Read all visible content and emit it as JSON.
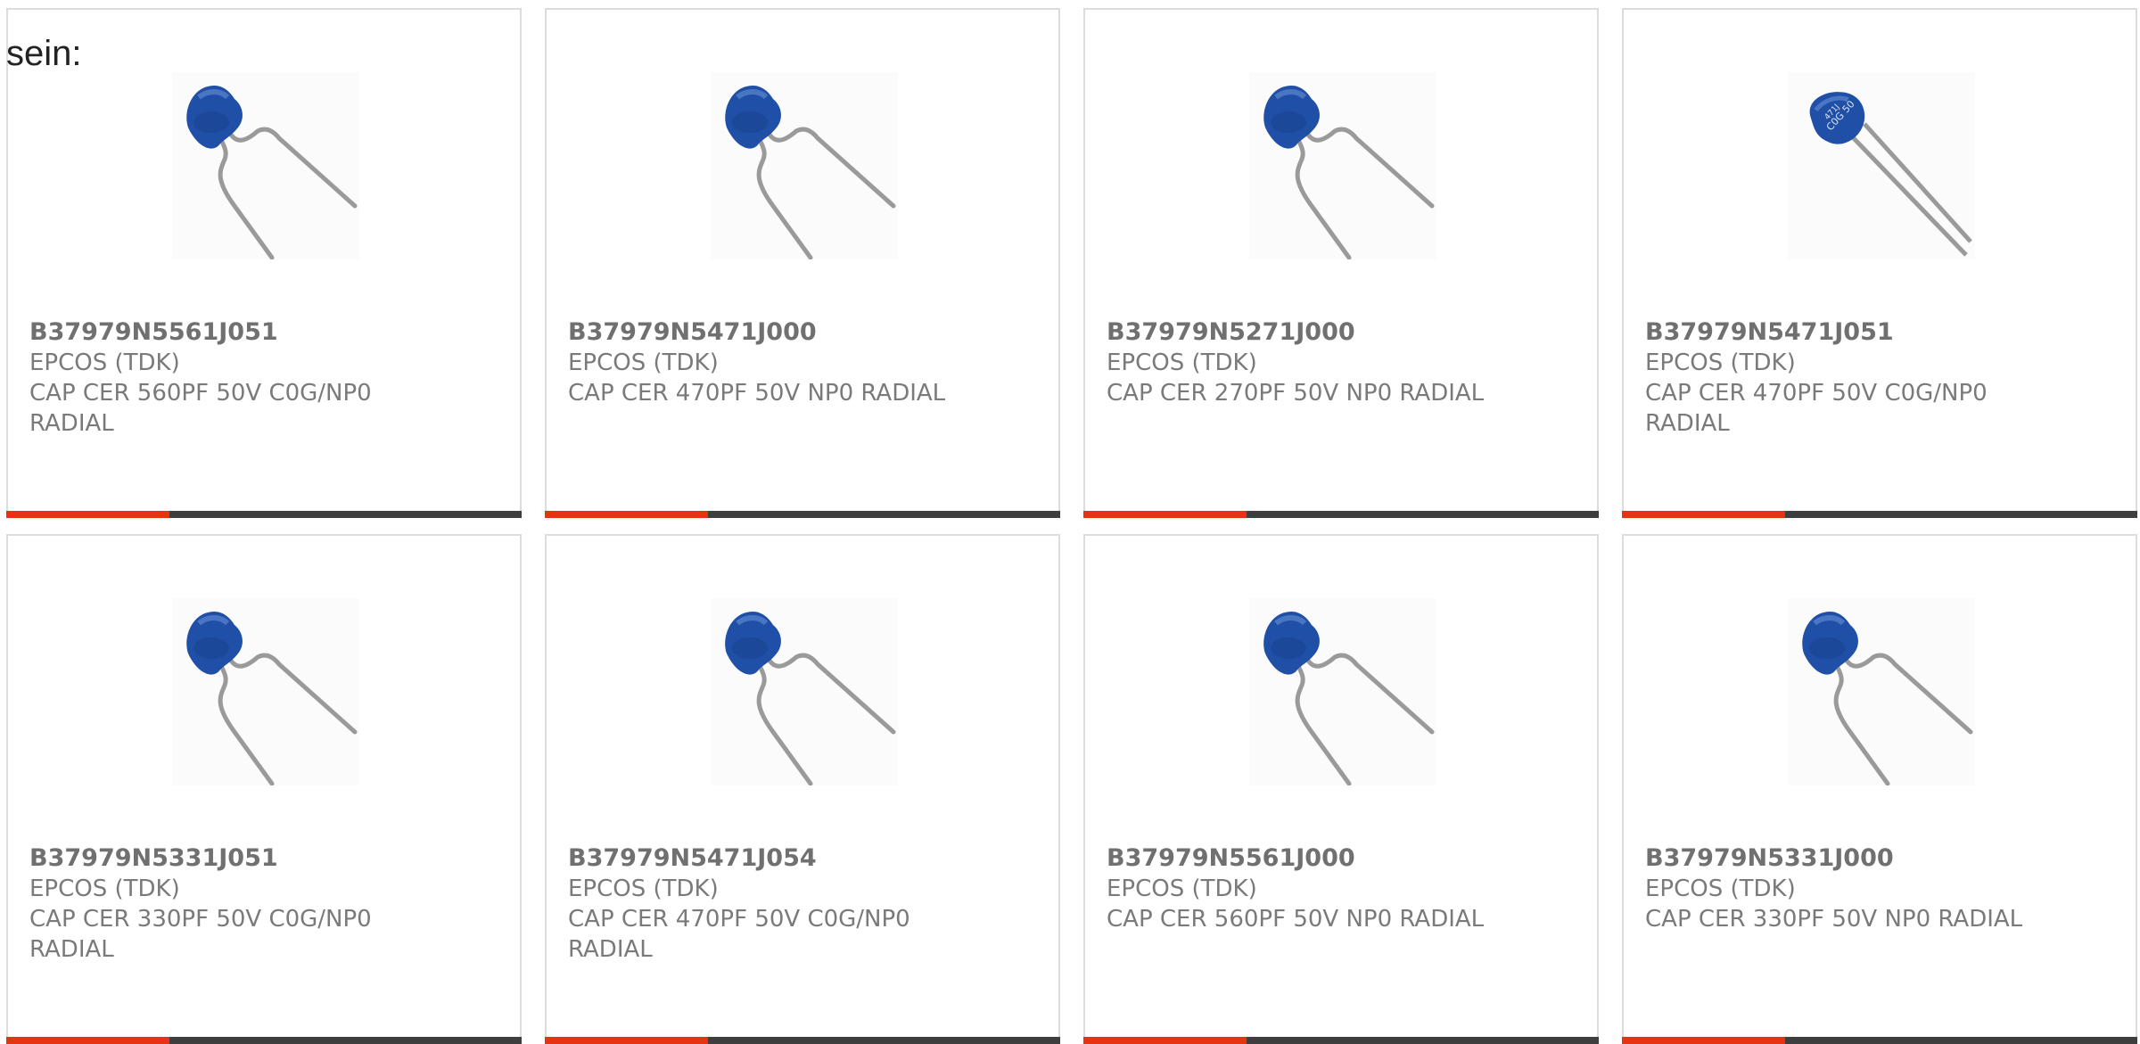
{
  "intro_text": "sein:",
  "accent_color": "#e63312",
  "bar_color": "#3e3e3e",
  "products": [
    {
      "part_number": "B37979N5561J051",
      "manufacturer": "EPCOS (TDK)",
      "description": "CAP CER 560PF 50V C0G/NP0 RADIAL",
      "image": "ceramic-capacitor"
    },
    {
      "part_number": "B37979N5471J000",
      "manufacturer": "EPCOS (TDK)",
      "description": "CAP CER 470PF 50V NP0 RADIAL",
      "image": "ceramic-capacitor"
    },
    {
      "part_number": "B37979N5271J000",
      "manufacturer": "EPCOS (TDK)",
      "description": "CAP CER 270PF 50V NP0 RADIAL",
      "image": "ceramic-capacitor"
    },
    {
      "part_number": "B37979N5471J051",
      "manufacturer": "EPCOS (TDK)",
      "description": "CAP CER 470PF 50V C0G/NP0 RADIAL",
      "image": "ceramic-capacitor-marked"
    },
    {
      "part_number": "B37979N5331J051",
      "manufacturer": "EPCOS (TDK)",
      "description": "CAP CER 330PF 50V C0G/NP0 RADIAL",
      "image": "ceramic-capacitor"
    },
    {
      "part_number": "B37979N5471J054",
      "manufacturer": "EPCOS (TDK)",
      "description": "CAP CER 470PF 50V C0G/NP0 RADIAL",
      "image": "ceramic-capacitor"
    },
    {
      "part_number": "B37979N5561J000",
      "manufacturer": "EPCOS (TDK)",
      "description": "CAP CER 560PF 50V NP0 RADIAL",
      "image": "ceramic-capacitor"
    },
    {
      "part_number": "B37979N5331J000",
      "manufacturer": "EPCOS (TDK)",
      "description": "CAP CER 330PF 50V NP0 RADIAL",
      "image": "ceramic-capacitor"
    }
  ]
}
